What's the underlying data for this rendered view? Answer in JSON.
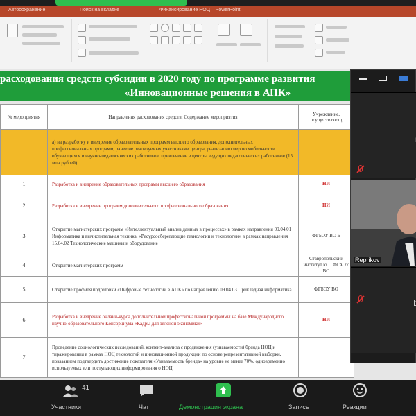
{
  "zoom": {
    "toolbar": {
      "participants": {
        "label": "Участники",
        "count": "41"
      },
      "chat": {
        "label": "Чат"
      },
      "share": {
        "label": "Демонстрация экрана"
      },
      "record": {
        "label": "Запись"
      },
      "reactions": {
        "label": "Реакции"
      }
    },
    "video_panel": {
      "tiles": [
        {
          "letter": "r"
        },
        {
          "name": "Reprikov"
        },
        {
          "letter": "b"
        }
      ]
    }
  },
  "powerpoint": {
    "window_title": "Финансирование НОЦ – PowerPoint",
    "title_left": "Автосохранение",
    "search_hint": "Поиск на вкладке"
  },
  "slide": {
    "banner": {
      "line1": "расходования средств субсидии в 2020 году по программе развития",
      "line2": "«Инновационные решения в АПК»"
    },
    "table": {
      "headers": {
        "col_num": "№ мероприятия",
        "col_dir": "Направления расходования средств: Содержание мероприятия",
        "col_org": "Учреждение, осуществляющ"
      },
      "rows": [
        {
          "type": "yellow",
          "num": "",
          "text": "а) на разработку и внедрение образовательных программ высшего образования, дополнительных профессиональных программ, ранее не реализуемых участниками центра, реализацию мер по мобильности обучающихся и научно-педагогических работников, привлечение в центры ведущих педагогических работников (15 млн рублей)",
          "org": ""
        },
        {
          "type": "red",
          "num": "1",
          "text": "Разработка и внедрение образовательных программ высшего образования",
          "org": "НИ"
        },
        {
          "type": "red",
          "num": "2",
          "text": "Разработка и внедрение программ дополнительного профессионального образования",
          "org": "НИ"
        },
        {
          "type": "plain",
          "num": "3",
          "text": "Открытие магистерских программ «Интеллектуальный анализ данных в процессах» в рамках направления 09.04.01 Информатика и вычислительная техника, «Ресурсосберегающие технологии и технологии» в рамках направления 15.04.02 Технологические машины и оборудование",
          "org": "ФГБОУ ВО Б"
        },
        {
          "type": "plain",
          "num": "4",
          "text": "Открытие магистерских программ",
          "org": "Ставропольский институт ю… ФГАОУ ВО"
        },
        {
          "type": "plain",
          "num": "5",
          "text": "Открытие профиля подготовки «Цифровые технологии в АПК» по направлению 09.04.03 Прикладная информатика",
          "org": "ФГБОУ ВО"
        },
        {
          "type": "red",
          "num": "6",
          "text": "Разработка и внедрение онлайн-курса дополнительной профессиональной программы на базе Международного научно-образовательного Консорциума «Кадры для зеленой экономики»",
          "org": "НИ"
        },
        {
          "type": "plain",
          "num": "7",
          "text": "Проведение социологических исследований, контент-анализа с продвижения (узнаваемости) бренда НОЦ и тиражирования в рамках НОЦ технологий и инновационной продукции по основе репрезентативной выборки, показанием подтвердить достижение показателя «Узнаваемость бренда» на уровне не менее 70%, одновременно используемых или поступающих информирования о НОЦ",
          "org": ""
        }
      ]
    }
  },
  "colors": {
    "ppt_titlebar": "#b7472a",
    "banner_green": "#1f9d3a",
    "highlight_yellow": "#f2b928",
    "zoom_green": "#2fbf4f"
  }
}
